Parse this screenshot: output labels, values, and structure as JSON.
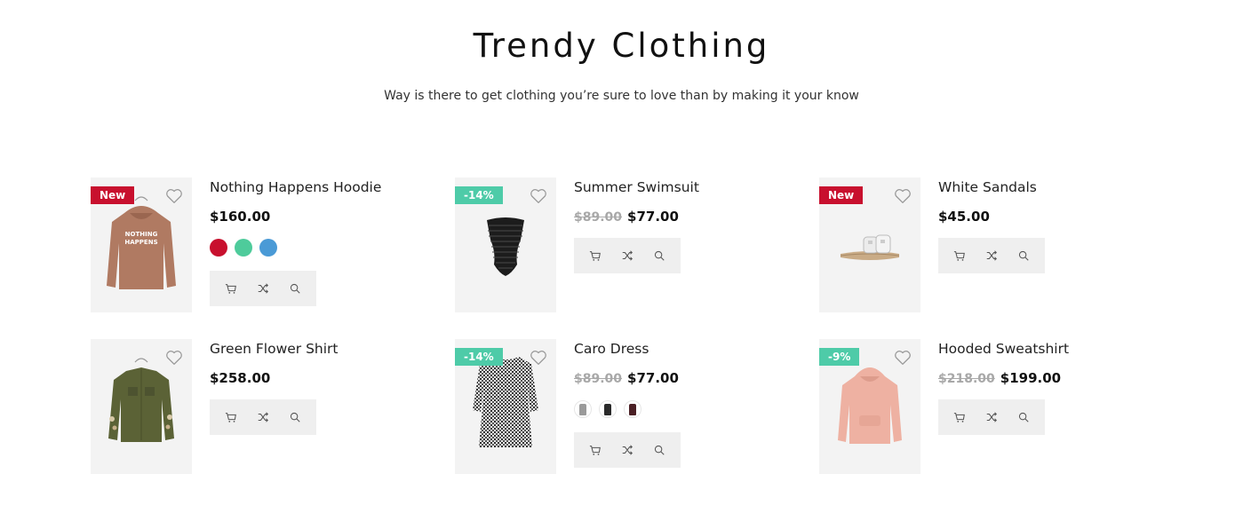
{
  "section": {
    "title": "Trendy Clothing",
    "subtitle": "Way is there to get clothing you’re sure to love than by making it your know"
  },
  "colors": {
    "badge_new": "#c8102e",
    "badge_sale": "#4ecba8",
    "action_bg": "#efefef",
    "thumb_bg": "#f3f3f3"
  },
  "icons": {
    "wishlist": "heart-icon",
    "cart": "cart-icon",
    "compare": "shuffle-icon",
    "quickview": "search-icon"
  },
  "products": [
    {
      "name": "Nothing Happens Hoodie",
      "badge": "New",
      "old_price": "",
      "price": "$160.00",
      "swatches": [
        "#c8102e",
        "#4ecb9b",
        "#4a9ad6"
      ]
    },
    {
      "name": "Summer Swimsuit",
      "badge": "-14%",
      "old_price": "$89.00",
      "price": "$77.00"
    },
    {
      "name": "White Sandals",
      "badge": "New",
      "old_price": "",
      "price": "$45.00"
    },
    {
      "name": "Green Flower Shirt",
      "badge": "",
      "old_price": "",
      "price": "$258.00"
    },
    {
      "name": "Caro Dress",
      "badge": "-14%",
      "old_price": "$89.00",
      "price": "$77.00",
      "swatches": [
        "#9a9a9a",
        "#2a2a2a",
        "#4a1f24"
      ]
    },
    {
      "name": "Hooded Sweatshirt",
      "badge": "-9%",
      "old_price": "$218.00",
      "price": "$199.00"
    }
  ]
}
